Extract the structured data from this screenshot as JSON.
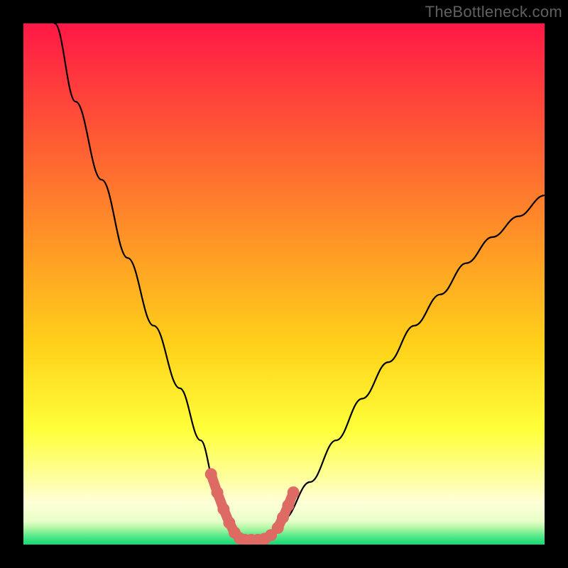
{
  "watermark": "TheBottleneck.com",
  "colors": {
    "frame_bg": "#000000",
    "gradient_top": "#ff1846",
    "gradient_mid_upper": "#ff6e2c",
    "gradient_mid": "#ffd21a",
    "gradient_lower": "#ffff73",
    "gradient_pale": "#ffffd0",
    "gradient_bottom": "#1be07a",
    "curve_stroke": "#000000",
    "marker_fill": "#dd6a63"
  },
  "chart_data": {
    "type": "line",
    "title": "",
    "xlabel": "",
    "ylabel": "",
    "xlim": [
      0,
      100
    ],
    "ylim": [
      0,
      100
    ],
    "series": [
      {
        "name": "bottleneck-curve",
        "x": [
          6,
          10,
          15,
          20,
          25,
          30,
          34,
          37,
          39,
          41,
          43,
          46,
          50,
          55,
          60,
          65,
          70,
          75,
          80,
          85,
          90,
          95,
          100
        ],
        "y": [
          100,
          85,
          70,
          55,
          42,
          30,
          20,
          11,
          5,
          2,
          1,
          1,
          5,
          12,
          20,
          28,
          35,
          42,
          48,
          54,
          59,
          63,
          67
        ]
      }
    ],
    "markers": [
      {
        "name": "optimal-left",
        "x": [
          36.0,
          37.2,
          38.4,
          39.5,
          40.5,
          41.5
        ],
        "y": [
          13.5,
          10.0,
          6.8,
          4.2,
          2.3,
          1.2
        ]
      },
      {
        "name": "optimal-bottom",
        "x": [
          42.5,
          43.7,
          45.0,
          46.3,
          47.5
        ],
        "y": [
          0.9,
          0.9,
          0.9,
          1.1,
          1.8
        ]
      },
      {
        "name": "optimal-right",
        "x": [
          48.8,
          49.8,
          50.8,
          51.8
        ],
        "y": [
          3.2,
          5.2,
          7.5,
          10.0
        ]
      }
    ]
  }
}
